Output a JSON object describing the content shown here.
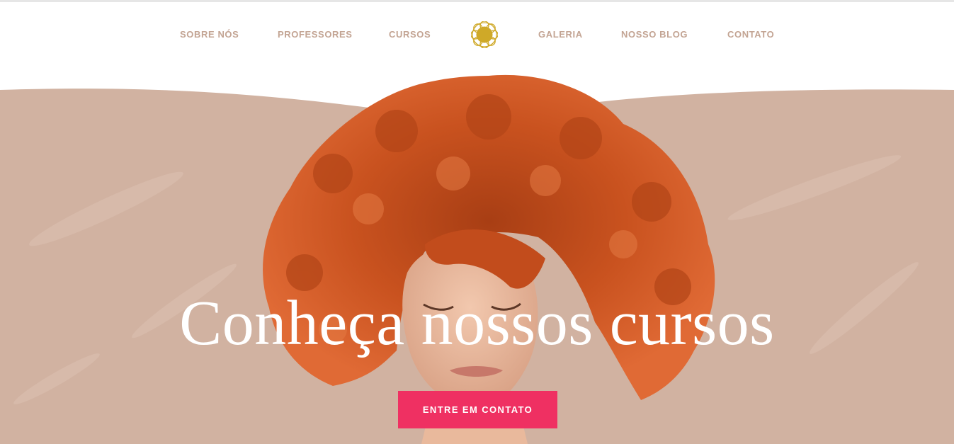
{
  "nav": {
    "items": [
      {
        "label": "SOBRE NÓS"
      },
      {
        "label": "PROFESSORES"
      },
      {
        "label": "CURSOS"
      },
      {
        "label": "GALERIA"
      },
      {
        "label": "NOSSO BLOG"
      },
      {
        "label": "CONTATO"
      }
    ],
    "logo_icon": "gold-flower-logo-icon"
  },
  "hero": {
    "headline": "Conheça nossos cursos",
    "cta_label": "ENTRE EM CONTATO",
    "image": "woman-red-curly-hair-photo"
  },
  "colors": {
    "nav_text": "#c3a493",
    "hero_bg": "#d1b2a1",
    "cta_bg": "#ef3062",
    "logo": "#cfa928",
    "hair": "#c9521f"
  }
}
